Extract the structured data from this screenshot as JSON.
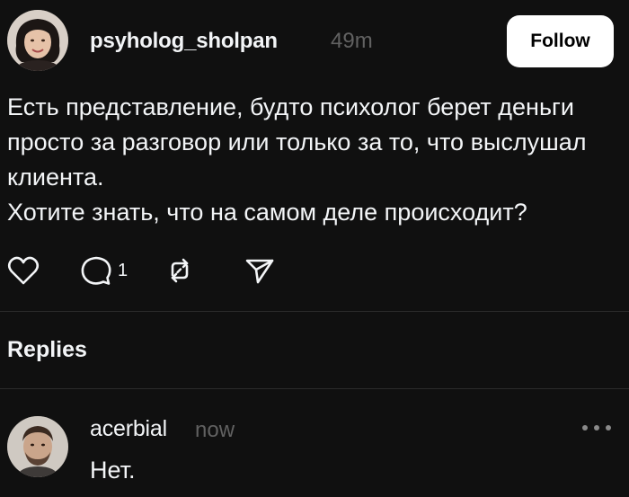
{
  "post": {
    "username": "psyholog_sholpan",
    "time": "49m",
    "follow_label": "Follow",
    "paragraphs": [
      "Есть представление, будто психолог берет деньги просто за разговор или только за то, что выслушал клиента.",
      "Хотите знать, что на самом деле происходит?"
    ],
    "comment_count": "1",
    "icons": {
      "like": "heart-icon",
      "comment": "comment-icon",
      "repost": "repost-icon",
      "share": "send-icon"
    }
  },
  "replies": {
    "heading": "Replies",
    "items": [
      {
        "username": "acerbial",
        "time": "now",
        "text": "Нет.",
        "more_icon": "more-dots-icon"
      }
    ]
  },
  "colors": {
    "background": "#101010",
    "text": "#f3f5f7",
    "muted": "#616161",
    "divider": "#2b2b2b",
    "button_bg": "#ffffff",
    "button_text": "#000000"
  }
}
